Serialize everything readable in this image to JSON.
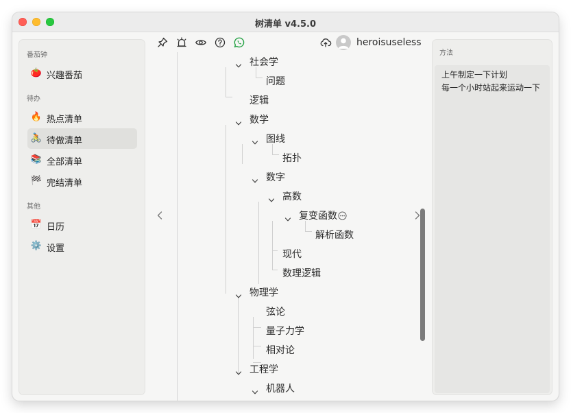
{
  "window": {
    "title": "树清单 v4.5.0"
  },
  "sidebar": {
    "sections": [
      {
        "heading": "番茄钟",
        "items": [
          {
            "label": "兴趣番茄",
            "icon": "tomato-icon",
            "glyph": "🍅"
          }
        ]
      },
      {
        "heading": "待办",
        "items": [
          {
            "label": "热点清单",
            "icon": "fire-icon",
            "glyph": "🔥"
          },
          {
            "label": "待做清单",
            "icon": "cyclist-icon",
            "glyph": "🚴",
            "active": true
          },
          {
            "label": "全部清单",
            "icon": "books-icon",
            "glyph": "📚"
          },
          {
            "label": "完结清单",
            "icon": "checkered-flag-icon",
            "glyph": "🏁"
          }
        ]
      },
      {
        "heading": "其他",
        "items": [
          {
            "label": "日历",
            "icon": "calendar-icon",
            "glyph": "📅"
          },
          {
            "label": "设置",
            "icon": "gear-icon",
            "glyph": "⚙️"
          }
        ]
      }
    ]
  },
  "toolbar": {
    "icons": [
      "pin-icon",
      "alarm-icon",
      "eye-icon",
      "help-icon",
      "whatsapp-icon"
    ],
    "user": {
      "name": "heroisuseless",
      "sync_icon": "cloud-sync-icon"
    }
  },
  "tree": {
    "nodes": [
      {
        "label": "社会学",
        "expanded": true
      },
      {
        "label": "问题"
      },
      {
        "label": "逻辑"
      },
      {
        "label": "数学",
        "expanded": true
      },
      {
        "label": "图线",
        "expanded": true
      },
      {
        "label": "拓扑"
      },
      {
        "label": "数字",
        "expanded": true
      },
      {
        "label": "高数",
        "expanded": true
      },
      {
        "label": "复变函数",
        "expanded": true,
        "has_more": true
      },
      {
        "label": "解析函数"
      },
      {
        "label": "现代"
      },
      {
        "label": "数理逻辑"
      },
      {
        "label": "物理学",
        "expanded": true
      },
      {
        "label": "弦论"
      },
      {
        "label": "量子力学"
      },
      {
        "label": "相对论"
      },
      {
        "label": "工程学",
        "expanded": true
      },
      {
        "label": "机器人",
        "expanded": true
      }
    ]
  },
  "right_panel": {
    "heading": "方法",
    "lines": [
      "上午制定一下计划",
      "每一个小时站起来运动一下"
    ]
  },
  "colors": {
    "active_item_bg": "#e0e0dd",
    "whatsapp_green": "#25a244",
    "scrollbar": "#7b7b7b"
  }
}
